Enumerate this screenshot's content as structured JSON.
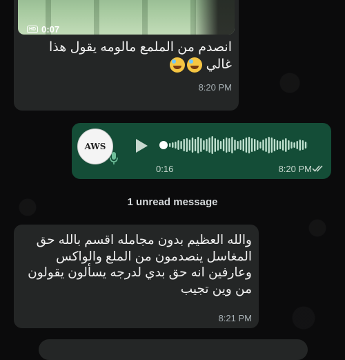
{
  "video_message": {
    "hd_badge": "HD",
    "duration": "0:07",
    "caption": "انصدم من الملمع مالومه يقول هذا غالي",
    "emojis": [
      "grinning-sweat-emoji",
      "grinning-sweat-emoji"
    ],
    "time": "8:20 PM"
  },
  "voice_message": {
    "avatar_text": "AWS",
    "duration": "0:16",
    "time": "8:20 PM",
    "status": "read",
    "colors": {
      "bubble": "#144d37",
      "wave": "#bfe0cf"
    }
  },
  "unread_divider": "1 unread message",
  "text_message": {
    "body": "والله العظيم بدون مجامله اقسم بالله حق المغاسل ينصدمون من الملع والواكس وعارفين انه حق بدي لدرجه يسألون يقولون من وين تجيب",
    "time": "8:21 PM"
  },
  "colors": {
    "incoming_bubble": "#242626",
    "background": "#0b0b0c"
  }
}
